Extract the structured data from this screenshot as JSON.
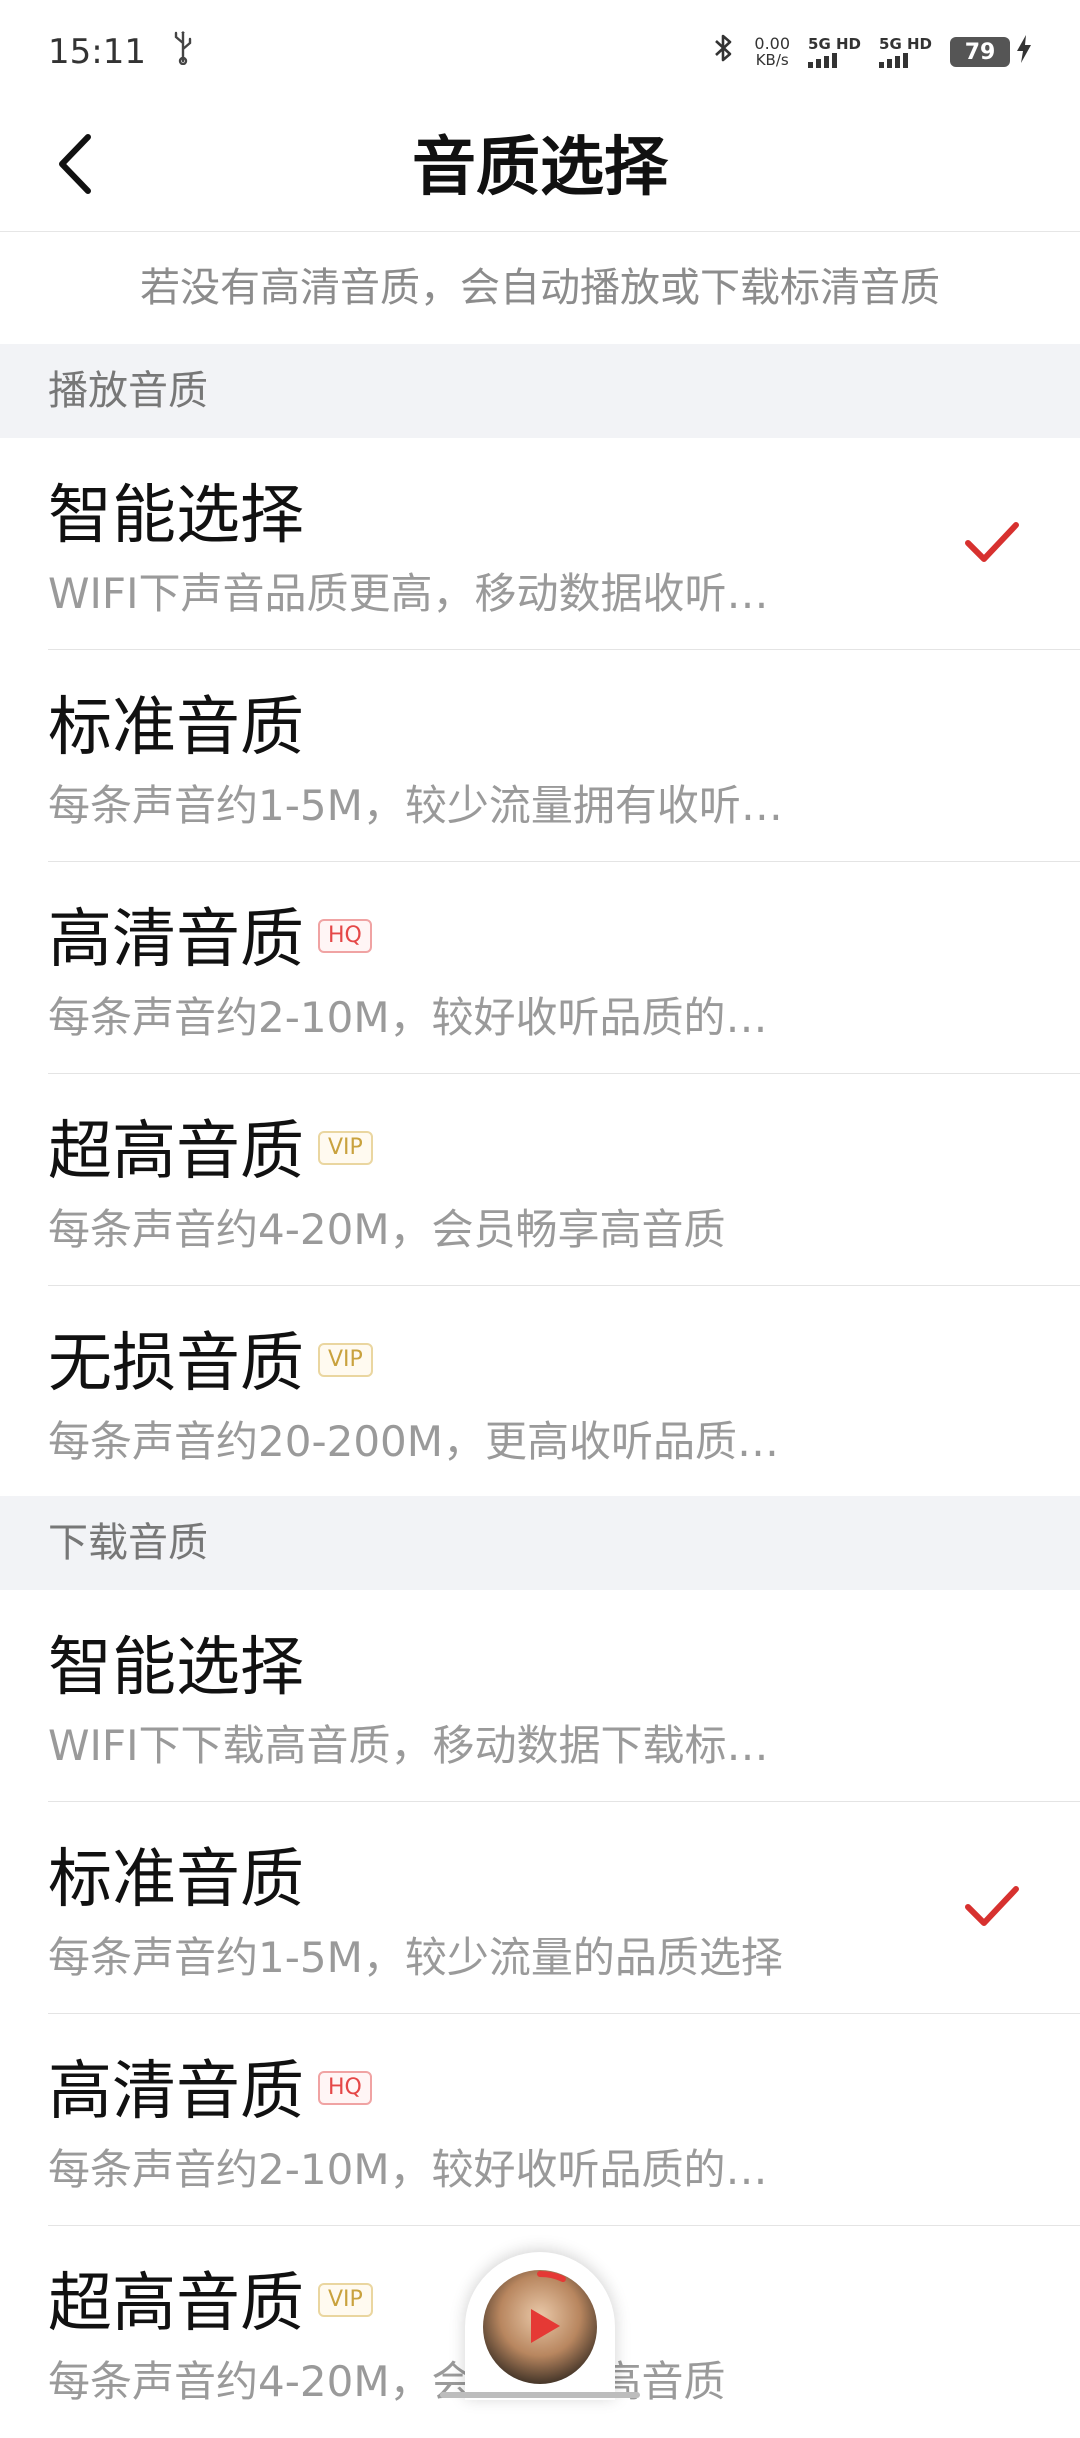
{
  "status_bar": {
    "time": "15:11",
    "net_speed_value": "0.00",
    "net_speed_unit": "KB/s",
    "sim1_label": "5G HD",
    "sim2_label": "5G HD",
    "battery_level": "79"
  },
  "header": {
    "title": "音质选择"
  },
  "hint": "若没有高清音质，会自动播放或下载标清音质",
  "playback": {
    "section_label": "播放音质",
    "options": [
      {
        "title": "智能选择",
        "badge": "",
        "desc": "WIFI下声音品质更高，移动数据收听…",
        "selected": true
      },
      {
        "title": "标准音质",
        "badge": "",
        "desc": "每条声音约1-5M，较少流量拥有收听…",
        "selected": false
      },
      {
        "title": "高清音质",
        "badge": "HQ",
        "desc": "每条声音约2-10M，较好收听品质的…",
        "selected": false
      },
      {
        "title": "超高音质",
        "badge": "VIP",
        "desc": "每条声音约4-20M，会员畅享高音质",
        "selected": false
      },
      {
        "title": "无损音质",
        "badge": "VIP",
        "desc": "每条声音约20-200M，更高收听品质…",
        "selected": false
      }
    ]
  },
  "download": {
    "section_label": "下载音质",
    "options": [
      {
        "title": "智能选择",
        "badge": "",
        "desc": "WIFI下下载高音质，移动数据下载标…",
        "selected": false
      },
      {
        "title": "标准音质",
        "badge": "",
        "desc": "每条声音约1-5M，较少流量的品质选择",
        "selected": true
      },
      {
        "title": "高清音质",
        "badge": "HQ",
        "desc": "每条声音约2-10M，较好收听品质的…",
        "selected": false
      },
      {
        "title": "超高音质",
        "badge": "VIP",
        "desc": "每条声音约4-20M，会员畅享高音质",
        "selected": false
      }
    ]
  },
  "colors": {
    "accent_red": "#d7312f",
    "section_bg": "#f2f3f6",
    "secondary_text": "#9a9a9a"
  },
  "icons": {
    "back": "chevron-left-icon",
    "check": "check-icon",
    "usb": "usb-icon",
    "bluetooth": "bluetooth-icon",
    "charging": "lightning-icon",
    "play": "play-icon"
  }
}
